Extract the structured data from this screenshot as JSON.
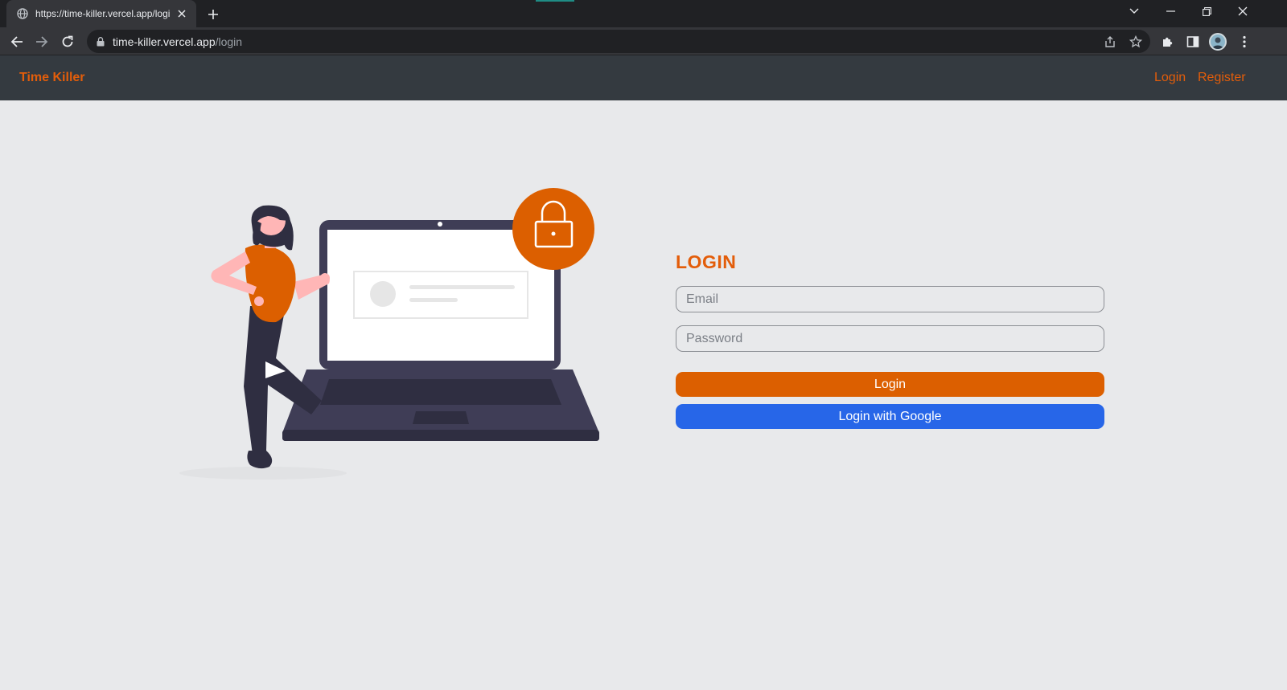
{
  "browser": {
    "tab_title": "https://time-killer.vercel.app/login",
    "url_host": "time-killer.vercel.app",
    "url_path": "/login"
  },
  "site": {
    "brand": "Time Killer",
    "nav": {
      "login": "Login",
      "register": "Register"
    }
  },
  "form": {
    "title": "LOGIN",
    "email_placeholder": "Email",
    "password_placeholder": "Password",
    "login_button": "Login",
    "google_button": "Login with Google"
  },
  "colors": {
    "accent_orange": "#dc5f00",
    "google_blue": "#2766e8",
    "navbar": "#343a40",
    "page_bg": "#e8e9eb"
  }
}
